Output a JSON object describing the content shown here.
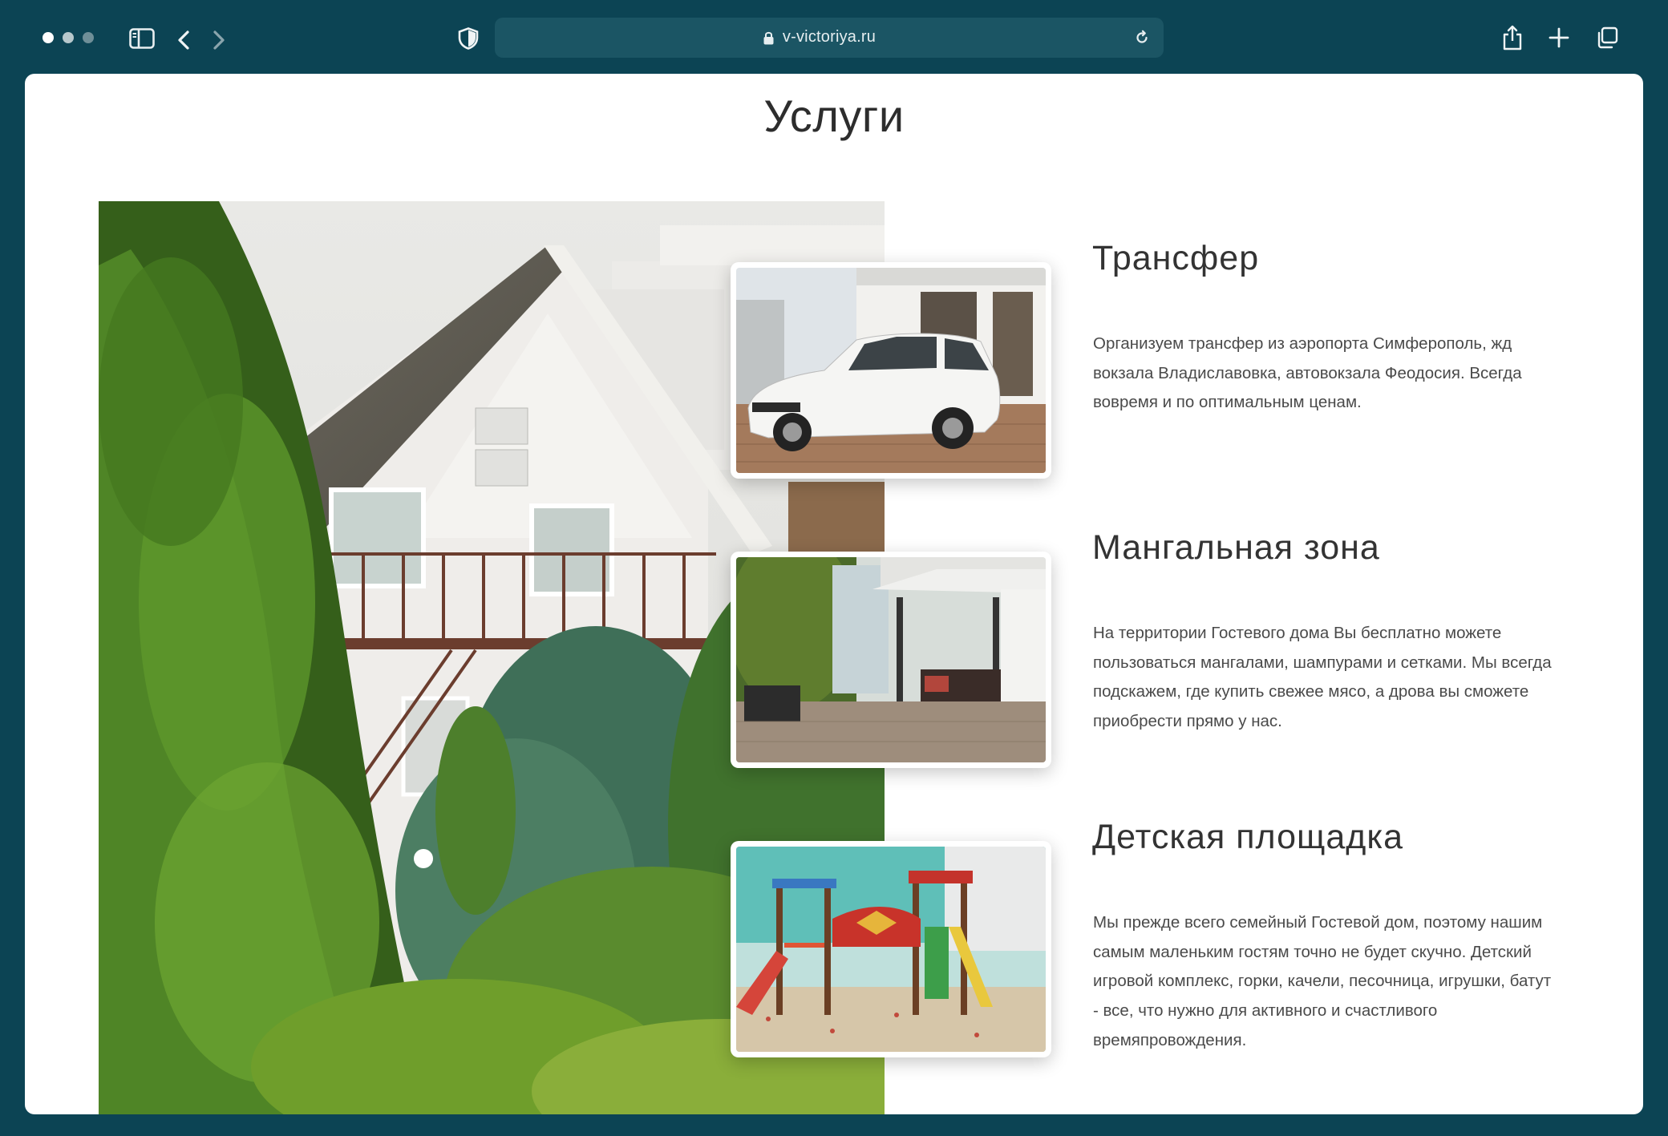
{
  "browser": {
    "url": "v-victoriya.ru",
    "icons": {
      "traffic_lights": "window-control-dots",
      "sidebar": "sidebar-icon",
      "back": "chevron-left-icon",
      "forward": "chevron-right-icon",
      "privacy": "shield-icon",
      "lock": "lock-icon",
      "reload": "reload-icon",
      "share": "share-icon",
      "new_tab": "plus-icon",
      "tabs": "tabs-overview-icon"
    },
    "colors": {
      "chrome": "#0c4454",
      "address_bar": "#1b5564"
    }
  },
  "page": {
    "title": "Услуги",
    "services": [
      {
        "title": "Трансфер",
        "text": "Организуем трансфер из аэропорта Симферополь, жд вокзала Владиславовка, автовокзала Феодосия. Всегда вовремя и по оптимальным ценам.",
        "image": "white-crossover-car-photo"
      },
      {
        "title": "Мангальная зона",
        "text": "На территории Гостевого дома Вы бесплатно можете пользоваться мангалами, шампурами и сетками. Мы всегда подскажем, где купить свежее мясо, а дрова вы сможете приобрести прямо у нас.",
        "image": "bbq-area-photo"
      },
      {
        "title": "Детская площадка",
        "text": "Мы прежде всего семейный Гостевой дом, поэтому нашим самым маленьким гостям точно не будет скучно. Детский игровой комплекс, горки, качели, песочница, игрушки, батут - все, что нужно для активного и счастливого времяпровождения.",
        "image": "playground-photo"
      }
    ],
    "hero_image": "guest-house-with-trees-photo"
  }
}
